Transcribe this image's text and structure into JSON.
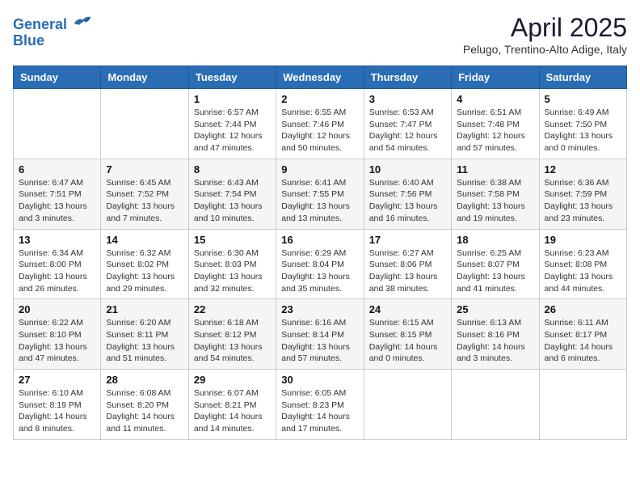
{
  "header": {
    "logo_line1": "General",
    "logo_line2": "Blue",
    "month": "April 2025",
    "location": "Pelugo, Trentino-Alto Adige, Italy"
  },
  "weekdays": [
    "Sunday",
    "Monday",
    "Tuesday",
    "Wednesday",
    "Thursday",
    "Friday",
    "Saturday"
  ],
  "weeks": [
    [
      {
        "day": "",
        "info": ""
      },
      {
        "day": "",
        "info": ""
      },
      {
        "day": "1",
        "info": "Sunrise: 6:57 AM\nSunset: 7:44 PM\nDaylight: 12 hours and 47 minutes."
      },
      {
        "day": "2",
        "info": "Sunrise: 6:55 AM\nSunset: 7:46 PM\nDaylight: 12 hours and 50 minutes."
      },
      {
        "day": "3",
        "info": "Sunrise: 6:53 AM\nSunset: 7:47 PM\nDaylight: 12 hours and 54 minutes."
      },
      {
        "day": "4",
        "info": "Sunrise: 6:51 AM\nSunset: 7:48 PM\nDaylight: 12 hours and 57 minutes."
      },
      {
        "day": "5",
        "info": "Sunrise: 6:49 AM\nSunset: 7:50 PM\nDaylight: 13 hours and 0 minutes."
      }
    ],
    [
      {
        "day": "6",
        "info": "Sunrise: 6:47 AM\nSunset: 7:51 PM\nDaylight: 13 hours and 3 minutes."
      },
      {
        "day": "7",
        "info": "Sunrise: 6:45 AM\nSunset: 7:52 PM\nDaylight: 13 hours and 7 minutes."
      },
      {
        "day": "8",
        "info": "Sunrise: 6:43 AM\nSunset: 7:54 PM\nDaylight: 13 hours and 10 minutes."
      },
      {
        "day": "9",
        "info": "Sunrise: 6:41 AM\nSunset: 7:55 PM\nDaylight: 13 hours and 13 minutes."
      },
      {
        "day": "10",
        "info": "Sunrise: 6:40 AM\nSunset: 7:56 PM\nDaylight: 13 hours and 16 minutes."
      },
      {
        "day": "11",
        "info": "Sunrise: 6:38 AM\nSunset: 7:58 PM\nDaylight: 13 hours and 19 minutes."
      },
      {
        "day": "12",
        "info": "Sunrise: 6:36 AM\nSunset: 7:59 PM\nDaylight: 13 hours and 23 minutes."
      }
    ],
    [
      {
        "day": "13",
        "info": "Sunrise: 6:34 AM\nSunset: 8:00 PM\nDaylight: 13 hours and 26 minutes."
      },
      {
        "day": "14",
        "info": "Sunrise: 6:32 AM\nSunset: 8:02 PM\nDaylight: 13 hours and 29 minutes."
      },
      {
        "day": "15",
        "info": "Sunrise: 6:30 AM\nSunset: 8:03 PM\nDaylight: 13 hours and 32 minutes."
      },
      {
        "day": "16",
        "info": "Sunrise: 6:29 AM\nSunset: 8:04 PM\nDaylight: 13 hours and 35 minutes."
      },
      {
        "day": "17",
        "info": "Sunrise: 6:27 AM\nSunset: 8:06 PM\nDaylight: 13 hours and 38 minutes."
      },
      {
        "day": "18",
        "info": "Sunrise: 6:25 AM\nSunset: 8:07 PM\nDaylight: 13 hours and 41 minutes."
      },
      {
        "day": "19",
        "info": "Sunrise: 6:23 AM\nSunset: 8:08 PM\nDaylight: 13 hours and 44 minutes."
      }
    ],
    [
      {
        "day": "20",
        "info": "Sunrise: 6:22 AM\nSunset: 8:10 PM\nDaylight: 13 hours and 47 minutes."
      },
      {
        "day": "21",
        "info": "Sunrise: 6:20 AM\nSunset: 8:11 PM\nDaylight: 13 hours and 51 minutes."
      },
      {
        "day": "22",
        "info": "Sunrise: 6:18 AM\nSunset: 8:12 PM\nDaylight: 13 hours and 54 minutes."
      },
      {
        "day": "23",
        "info": "Sunrise: 6:16 AM\nSunset: 8:14 PM\nDaylight: 13 hours and 57 minutes."
      },
      {
        "day": "24",
        "info": "Sunrise: 6:15 AM\nSunset: 8:15 PM\nDaylight: 14 hours and 0 minutes."
      },
      {
        "day": "25",
        "info": "Sunrise: 6:13 AM\nSunset: 8:16 PM\nDaylight: 14 hours and 3 minutes."
      },
      {
        "day": "26",
        "info": "Sunrise: 6:11 AM\nSunset: 8:17 PM\nDaylight: 14 hours and 6 minutes."
      }
    ],
    [
      {
        "day": "27",
        "info": "Sunrise: 6:10 AM\nSunset: 8:19 PM\nDaylight: 14 hours and 8 minutes."
      },
      {
        "day": "28",
        "info": "Sunrise: 6:08 AM\nSunset: 8:20 PM\nDaylight: 14 hours and 11 minutes."
      },
      {
        "day": "29",
        "info": "Sunrise: 6:07 AM\nSunset: 8:21 PM\nDaylight: 14 hours and 14 minutes."
      },
      {
        "day": "30",
        "info": "Sunrise: 6:05 AM\nSunset: 8:23 PM\nDaylight: 14 hours and 17 minutes."
      },
      {
        "day": "",
        "info": ""
      },
      {
        "day": "",
        "info": ""
      },
      {
        "day": "",
        "info": ""
      }
    ]
  ]
}
